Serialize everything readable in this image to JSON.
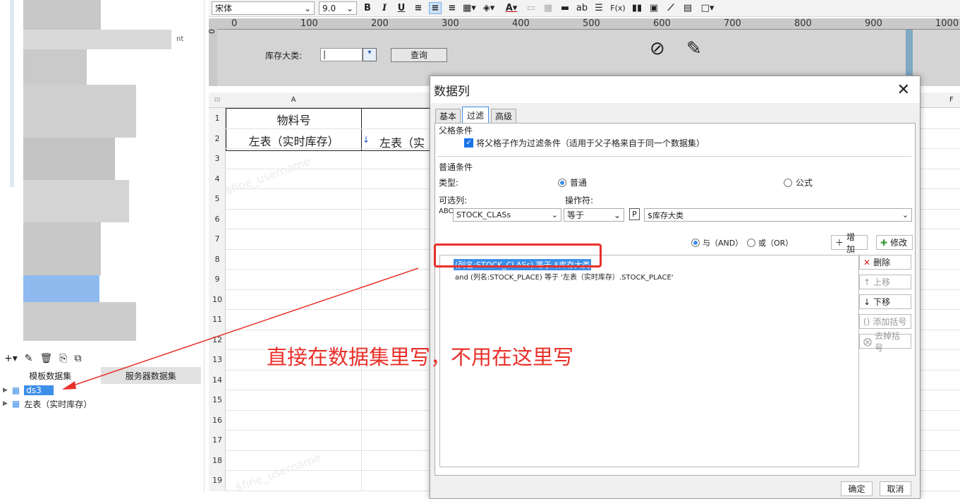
{
  "left": {
    "blurred_text": "nt",
    "tabs": [
      "模板数据集",
      "服务器数据集"
    ],
    "tree": [
      {
        "label": "ds3"
      },
      {
        "label": "左表（实时库存）"
      }
    ]
  },
  "toolbar": {
    "font_name": "宋体",
    "font_size": "9.0",
    "bold": "B",
    "italic": "I",
    "underline": "U",
    "text_ab": "ab",
    "formula": "F(x)"
  },
  "ruler": {
    "ticks": [
      "0",
      "100",
      "200",
      "300",
      "400",
      "500",
      "600",
      "700",
      "800",
      "900",
      "1000"
    ],
    "v_zero": "0"
  },
  "param_panel": {
    "label": "库存大类:",
    "query_button": "查询"
  },
  "sheet": {
    "col_a": "A",
    "col_f": "F",
    "rows": [
      "1",
      "2",
      "3",
      "4",
      "5",
      "6",
      "7",
      "8",
      "9",
      "10",
      "11",
      "12",
      "13",
      "14",
      "15",
      "16",
      "17",
      "18",
      "19"
    ],
    "cell_a1": "物料号",
    "cell_a2": "左表（实时库存）",
    "cell_b2": "左表（实"
  },
  "annotation": {
    "text": "直接在数据集里写，不用在这里写",
    "color": "#e8302a"
  },
  "dialog": {
    "title": "数据列",
    "tabs": [
      "基本",
      "过滤",
      "高级"
    ],
    "parent_section": "父格条件",
    "parent_checkbox": "将父格子作为过滤条件（适用于父子格来自于同一个数据集）",
    "normal_section": "普通条件",
    "type_label": "类型:",
    "type_normal": "普通",
    "type_formula": "公式",
    "column_label": "可选列:",
    "operator_label": "操作符:",
    "column_value": "STOCK_CLASs",
    "operator_value": "等于",
    "param_icon": "P",
    "param_value": "$库存大类",
    "and_label": "与（AND）",
    "or_label": "或（OR）",
    "add_button": "增加",
    "modify_button": "修改",
    "delete_button": "删除",
    "up_button": "上移",
    "down_button": "下移",
    "add_bracket_button": "添加括号",
    "remove_bracket_button": "去掉括号",
    "conditions": [
      "(列名:STOCK_CLASs) 等于 $库存大类",
      "and (列名:STOCK_PLACE) 等于 '左表（实时库存）.STOCK_PLACE'"
    ],
    "ok_button": "确定",
    "cancel_button": "取消"
  },
  "watermark": "$fine_username"
}
